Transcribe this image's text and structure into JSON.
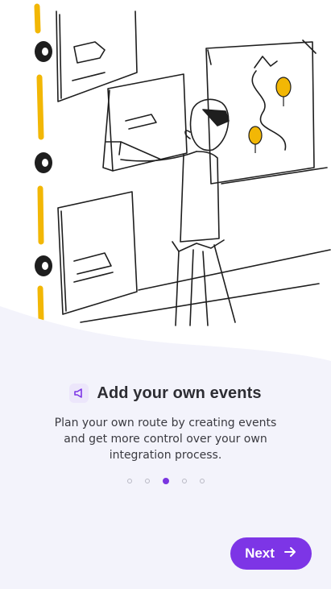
{
  "onboarding": {
    "title": "Add your own events",
    "description": "Plan your own route by creating events and get more control over your own integration process.",
    "title_icon": "speaker-icon",
    "page_indicator": {
      "total": 5,
      "current": 3
    },
    "next_label": "Next",
    "next_icon": "arrow-right-icon"
  },
  "colors": {
    "accent": "#7d35e6",
    "sheet": "#f3f3fb",
    "illustration_accent": "#f2b705",
    "text": "#2d2d33"
  }
}
